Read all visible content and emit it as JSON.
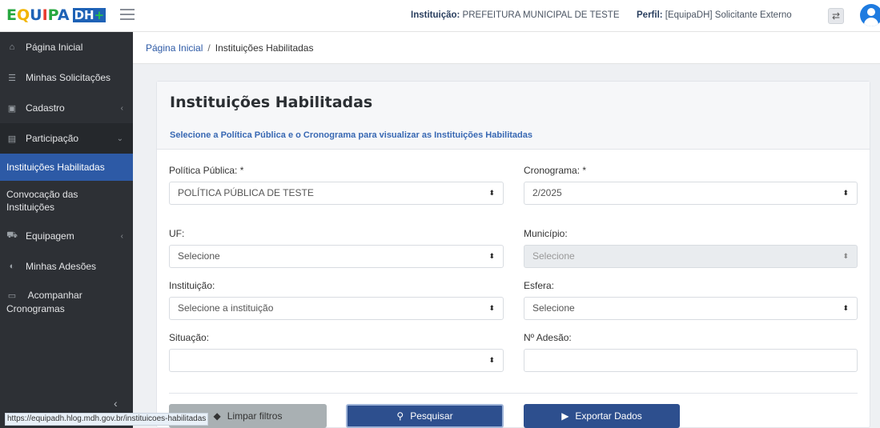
{
  "header": {
    "logo_text": "EQUIPADH+",
    "logo_equipa": "EQUIPA",
    "logo_dh": "DH",
    "logo_plus": "+",
    "instituicao_label": "Instituição:",
    "instituicao_value": "PREFEITURA MUNICIPAL DE TESTE",
    "perfil_label": "Perfil:",
    "perfil_value": "[EquipaDH] Solicitante Externo",
    "swap_icon": "⇄"
  },
  "sidebar": {
    "items": [
      {
        "label": "Página Inicial",
        "icon": "home-icon"
      },
      {
        "label": "Minhas Solicitações",
        "icon": "list-icon"
      },
      {
        "label": "Cadastro",
        "icon": "id-card-icon"
      },
      {
        "label": "Participação",
        "icon": "vcard-icon"
      },
      {
        "label": "Instituições Habilitadas"
      },
      {
        "label": "Convocação das Instituições"
      },
      {
        "label": "Equipagem",
        "icon": "truck-icon"
      },
      {
        "label": "Minhas Adesões",
        "icon": "shield-icon"
      },
      {
        "label": "Acompanhar Cronogramas",
        "icon": "calendar-icon"
      }
    ]
  },
  "breadcrumb": {
    "home": "Página Inicial",
    "separator": "/",
    "current": "Instituições Habilitadas"
  },
  "main": {
    "title": "Instituições Habilitadas",
    "subtitle": "Selecione a Política Pública e o Cronograma para visualizar as Instituições Habilitadas",
    "fields": {
      "politica_label": "Política Pública: *",
      "politica_value": "POLÍTICA PÚBLICA DE TESTE",
      "cronograma_label": "Cronograma: *",
      "cronograma_value": "2/2025",
      "uf_label": "UF:",
      "uf_value": "Selecione",
      "municipio_label": "Município:",
      "municipio_value": "Selecione",
      "instituicao_label": "Instituição:",
      "instituicao_value": "Selecione a instituição",
      "esfera_label": "Esfera:",
      "esfera_value": "Selecione",
      "situacao_label": "Situação:",
      "situacao_value": "",
      "adesao_label": "Nº Adesão:",
      "adesao_value": ""
    },
    "buttons": {
      "clear": "Limpar filtros",
      "search": "Pesquisar",
      "export": "Exportar Dados"
    }
  },
  "status_url": "https://equipadh.hlog.mdh.gov.br/instituicoes-habilitadas"
}
